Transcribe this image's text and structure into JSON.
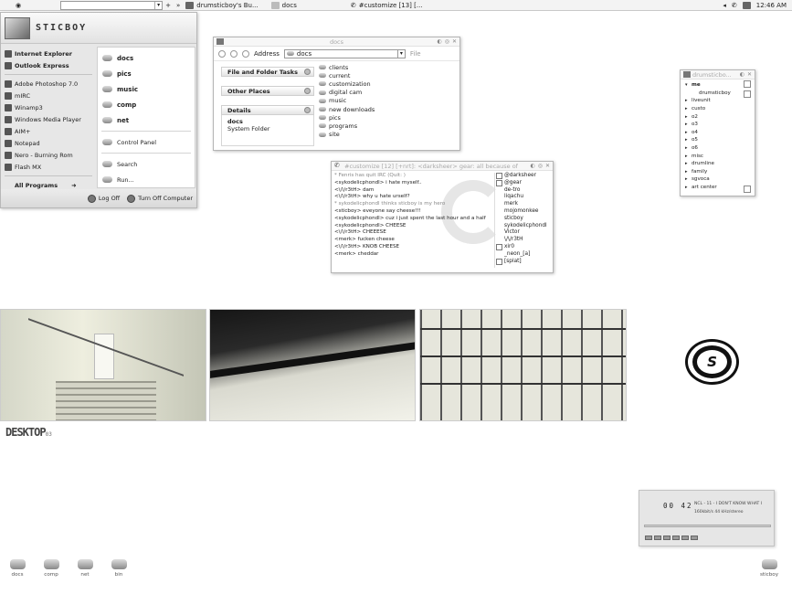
{
  "taskbar": {
    "tasks": [
      {
        "label": "drumsticboy's Bu...",
        "icon": "irc-icon"
      },
      {
        "label": "docs",
        "icon": "folder-icon"
      },
      {
        "label": "#customize [13] [...",
        "icon": "irc-icon"
      }
    ],
    "clock": "12:46 AM",
    "plus": "+",
    "chevrons": "»"
  },
  "start_menu": {
    "user": "STICBOY",
    "pinned": [
      {
        "label": "Internet Explorer",
        "bold": true
      },
      {
        "label": "Outlook Express",
        "bold": true
      }
    ],
    "recent": [
      "Adobe Photoshop 7.0",
      "mIRC",
      "Winamp3",
      "Windows Media Player",
      "AIM+",
      "Notepad",
      "Nero - Burning Rom",
      "Flash MX"
    ],
    "all_programs": "All Programs",
    "places": [
      "docs",
      "pics",
      "music",
      "comp",
      "net"
    ],
    "control_panel": "Control Panel",
    "search": "Search",
    "run": "Run...",
    "log_off": "Log Off",
    "turn_off": "Turn Off Computer"
  },
  "docs_window": {
    "title": "docs",
    "address_label": "Address",
    "address_value": "docs",
    "menu_file": "File",
    "task_panels": [
      "File and Folder Tasks",
      "Other Places",
      "Details"
    ],
    "details_title": "docs",
    "details_sub": "System Folder",
    "files": [
      "clients",
      "current",
      "customization",
      "digital cam",
      "music",
      "new downloads",
      "pics",
      "programs",
      "site"
    ]
  },
  "irc_window": {
    "title": "#customize [12] [+nrt]: <darksheer> gear: all because of yo...",
    "messages": [
      {
        "text": "* Fenris has quit IRC (Quit: )",
        "sys": true
      },
      {
        "text": "<sykodelicphondl> i hate myself..",
        "sys": false
      },
      {
        "text": "<\\/\\/r3tH> dam",
        "sys": false
      },
      {
        "text": "<\\/\\/r3tH> why u hate urself?",
        "sys": false
      },
      {
        "text": "* sykodelicphondl thinks sticboy is my hero",
        "sys": true
      },
      {
        "text": "<sticboy> eveyone say cheese!!!",
        "sys": false
      },
      {
        "text": "<sykodelicphondl> cuz i just spent the last hour and a half",
        "sys": false
      },
      {
        "text": "<sykodelicphondl> CHEESE",
        "sys": false
      },
      {
        "text": "<\\/\\/r3tH> CHEEESE",
        "sys": false
      },
      {
        "text": "<merk> fucken cheese",
        "sys": false
      },
      {
        "text": "<\\/\\/r3tH> KNOB CHEESE",
        "sys": false
      },
      {
        "text": "<merk> cheddar",
        "sys": false
      }
    ],
    "users": [
      {
        "name": "@darksheer",
        "box": true
      },
      {
        "name": "@gear",
        "box": true
      },
      {
        "name": "de-tro",
        "box": false
      },
      {
        "name": "liqachu",
        "box": false
      },
      {
        "name": "merk",
        "box": false
      },
      {
        "name": "mojomonkee",
        "box": false
      },
      {
        "name": "sticboy",
        "box": false
      },
      {
        "name": "sykodelicphondl",
        "box": false
      },
      {
        "name": "Victor",
        "box": false
      },
      {
        "name": "\\/\\/r3tH",
        "box": false
      },
      {
        "name": "xir0",
        "box": true
      },
      {
        "name": "_neon_[a]",
        "box": false
      },
      {
        "name": "[splat]",
        "box": true
      }
    ]
  },
  "tree_window": {
    "title": "drumsticbo...",
    "items": [
      {
        "label": "me",
        "level": 0,
        "bold": true,
        "open": true
      },
      {
        "label": "drumsticboy",
        "level": 1,
        "bold": false
      },
      {
        "label": "liveunit",
        "level": 0
      },
      {
        "label": "custo",
        "level": 0
      },
      {
        "label": "o2",
        "level": 0
      },
      {
        "label": "o3",
        "level": 0
      },
      {
        "label": "o4",
        "level": 0
      },
      {
        "label": "o5",
        "level": 0
      },
      {
        "label": "o6",
        "level": 0
      },
      {
        "label": "misc",
        "level": 0
      },
      {
        "label": "drumline",
        "level": 0
      },
      {
        "label": "family",
        "level": 0
      },
      {
        "label": "sgvoca",
        "level": 0
      },
      {
        "label": "art center",
        "level": 0
      }
    ]
  },
  "branding": {
    "desktop_logo": "DESKTOP",
    "desktop_logo_sub": "03",
    "s_logo": "S"
  },
  "player": {
    "time": "00 42",
    "track_title": "NCL - 11 - I DON'T KNOW WHAT I",
    "track_info": "160kbit/s  44 kHz/stereo"
  },
  "desktop_icons": [
    "docs",
    "comp",
    "net",
    "bin"
  ],
  "recycle_icon": "sticboy"
}
